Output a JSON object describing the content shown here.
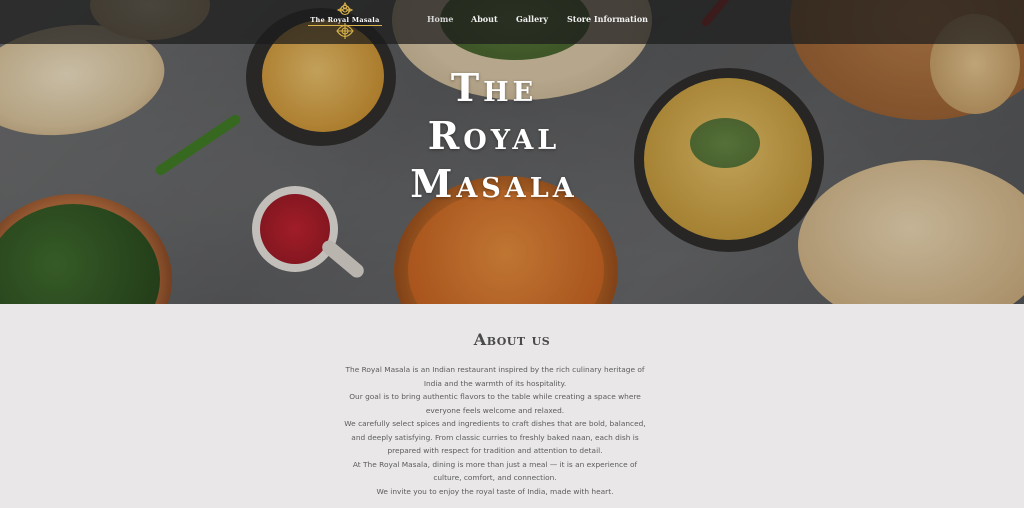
{
  "brand": {
    "logo_text": "The Royal Masala",
    "accent_color": "#d9b24a"
  },
  "nav": {
    "items": [
      {
        "label": "Home",
        "active": true
      },
      {
        "label": "About",
        "active": false
      },
      {
        "label": "Gallery",
        "active": false
      },
      {
        "label": "Store Information",
        "active": false
      }
    ]
  },
  "hero": {
    "title_lines": [
      "The",
      "Royal",
      "Masala"
    ]
  },
  "about": {
    "heading": "About us",
    "paragraph_lines": [
      "The Royal Masala is an Indian restaurant inspired by the rich culinary heritage of",
      "India and the warmth of its hospitality.",
      "Our goal is to bring authentic flavors to the table while creating a space where",
      "everyone feels welcome and relaxed.",
      "We carefully select spices and ingredients to craft dishes that are bold, balanced,",
      "and deeply satisfying. From classic curries to freshly baked naan, each dish is",
      "prepared with respect for tradition and attention to detail.",
      "At The Royal Masala, dining is more than just a meal — it is an experience of",
      "culture, comfort, and connection.",
      "We invite you to enjoy the royal taste of India, made with heart."
    ]
  },
  "colors": {
    "nav_background": "#1c1c1c",
    "about_background": "#e9e7e7",
    "body_text": "#5c5c5c"
  }
}
